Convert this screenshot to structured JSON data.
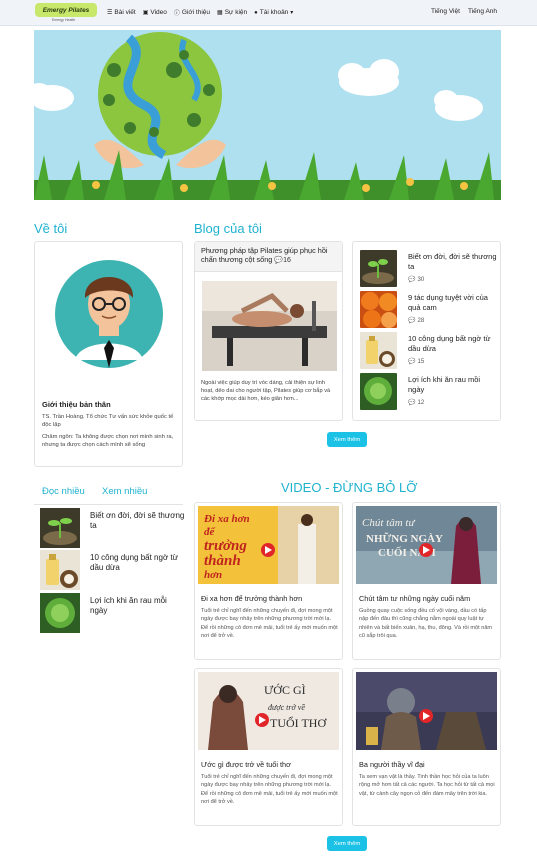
{
  "brand": {
    "logo_text": "Emergy Pilates",
    "logo_sub": "Emergy Health"
  },
  "nav": {
    "items": [
      {
        "icon": "list-icon",
        "label": "Bài viết"
      },
      {
        "icon": "film-icon",
        "label": "Video"
      },
      {
        "icon": "info-icon",
        "label": "Giới thiệu"
      },
      {
        "icon": "calendar-icon",
        "label": "Sự kiện"
      },
      {
        "icon": "user-icon",
        "label": "Tài khoản"
      }
    ],
    "lang_vi": "Tiếng Việt",
    "lang_en": "Tiếng Anh"
  },
  "about": {
    "heading": "Về tôi",
    "title": "Giới thiệu bản thân",
    "line1": "TS. Trần Hoàng. Tổ chức Tư vấn sức khỏe quốc tế độc lập",
    "line2": "Châm ngôn: Ta không được chọn nơi mình sinh ra, nhưng ta được chọn cách mình sẽ sống"
  },
  "blog": {
    "heading": "Blog của tôi",
    "featured": {
      "title": "Phương pháp tập Pilates giúp phục hồi chấn thương cột sống",
      "comments": "16",
      "desc": "Ngoài việc giúp duy trì vóc dáng, cải thiện sự linh hoạt, dẻo dai cho người tập, Pilates giúp cơ bắp và các khớp mọc dài hơn, kéo giãn hơn..."
    },
    "list": [
      {
        "title": "Biết ơn đời, đời sẽ thương ta",
        "comments": "30"
      },
      {
        "title": "9 tác dụng tuyệt vời của quả cam",
        "comments": "28"
      },
      {
        "title": "10 công dụng bất ngờ từ dầu dừa",
        "comments": "15"
      },
      {
        "title": "Lợi ích khi ăn rau mồi ngày",
        "comments": "12"
      }
    ],
    "more_label": "Xem thêm"
  },
  "popular": {
    "tab1": "Đọc nhiều",
    "tab2": "Xem nhiều",
    "items": [
      {
        "title": "Biết ơn đời, đời sẽ thương ta"
      },
      {
        "title": "10 công dụng bất ngờ từ dầu dừa"
      },
      {
        "title": "Lợi ích khi ăn rau mỗi ngày"
      }
    ]
  },
  "video": {
    "heading": "VIDEO - ĐỪNG BỎ LỠ",
    "items": [
      {
        "thumb_line1": "Đi xa hơn",
        "thumb_line2": "để",
        "thumb_line3": "trưởng",
        "thumb_line4": "thành",
        "thumb_line5": "hơn",
        "title": "Đi xa hơn để trưởng thành hơn",
        "desc": "Tuổi trẻ chỉ nghĩ đến những chuyến đi, đợi mong một ngày được bay nhảy trên những phương trời mới lạ. Để rồi những cô đơn mê mải, tuổi trẻ ấy mới muốn một nơi để trở về."
      },
      {
        "thumb_line1": "Chút tâm tư",
        "thumb_line2": "NHỮNG NGÀY",
        "thumb_line3": "CUỐI NĂM",
        "title": "Chút tâm tư những ngày cuối năm",
        "desc": "Guồng quay cuộc sống đều cố vội vàng, dầu có tấp nập đến đâu thì cũng chẳng nằm ngoài quy luật tự nhiên và bất biến xuân, hạ, thu, đông. Và rồi một năm cũ sắp trôi qua."
      },
      {
        "thumb_line1": "ƯỚC GÌ",
        "thumb_line2": "được trở về",
        "thumb_line3": "TUỔI THƠ",
        "title": "Ước gì được trở về tuổi thơ",
        "desc": "Tuổi trẻ chỉ nghĩ đến những chuyến đi, đợi mong một ngày được bay nhảy trên những phương trời mới lạ. Để rồi những cô đơn mê mải, tuổi trẻ ấy mới muốn một nơi để trở về."
      },
      {
        "title": "Ba người thầy vĩ đại",
        "desc": "Ta xem vạn vật là thầy. Tinh thần học hỏi của ta luôn rộng mở hơn tất cả các người. Ta học hỏi từ tất cả mọi vật, từ cành cây ngọn cỏ đến đám mây trên trời kia."
      }
    ],
    "more_label": "Xem thêm"
  },
  "colors": {
    "accent": "#1fb2cf",
    "button": "#1bc2e6",
    "play": "#e1262a"
  }
}
